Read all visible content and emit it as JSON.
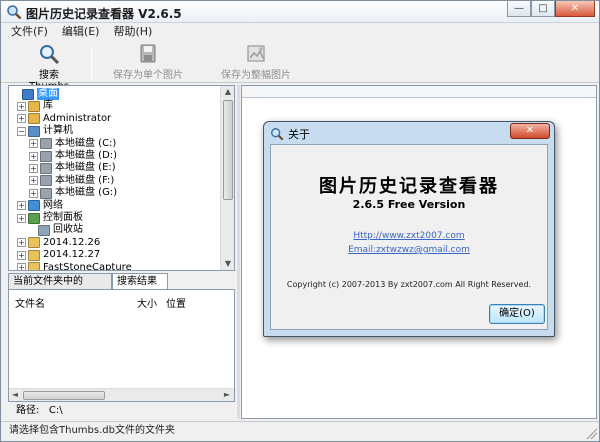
{
  "window": {
    "title": "图片历史记录查看器 V2.6.5",
    "minimize": "—",
    "maximize": "□",
    "close": "✕"
  },
  "menu": {
    "items": [
      "文件(F)",
      "编辑(E)",
      "帮助(H)"
    ]
  },
  "toolbar": {
    "search_label": "搜索Thumbs",
    "save_single_label": "保存为单个图片",
    "save_whole_label": "保存为整幅图片"
  },
  "tree": {
    "items": [
      {
        "label": "桌面",
        "icon": "desktop-icon",
        "expander": ""
      },
      {
        "label": "库",
        "icon": "library-icon",
        "expander": "+"
      },
      {
        "label": "Administrator",
        "icon": "user-folder-icon",
        "expander": "+"
      },
      {
        "label": "计算机",
        "icon": "computer-icon",
        "expander": "−"
      },
      {
        "label": "本地磁盘 (C:)",
        "icon": "drive-icon",
        "expander": "+"
      },
      {
        "label": "本地磁盘 (D:)",
        "icon": "drive-icon",
        "expander": "+"
      },
      {
        "label": "本地磁盘 (E:)",
        "icon": "drive-icon",
        "expander": "+"
      },
      {
        "label": "本地磁盘 (F:)",
        "icon": "drive-icon",
        "expander": "+"
      },
      {
        "label": "本地磁盘 (G:)",
        "icon": "drive-icon",
        "expander": "+"
      },
      {
        "label": "网络",
        "icon": "network-icon",
        "expander": "+"
      },
      {
        "label": "控制面板",
        "icon": "control-panel-icon",
        "expander": "+"
      },
      {
        "label": "回收站",
        "icon": "recycle-bin-icon",
        "expander": ""
      },
      {
        "label": "2014.12.26",
        "icon": "folder-icon",
        "expander": "+"
      },
      {
        "label": "2014.12.27",
        "icon": "folder-icon",
        "expander": "+"
      },
      {
        "label": "FastStoneCapture",
        "icon": "folder-icon",
        "expander": "+"
      }
    ]
  },
  "tabs": [
    {
      "label": "当前文件夹中的Thumbs",
      "active": false
    },
    {
      "label": "搜索结果",
      "active": true
    }
  ],
  "results": {
    "columns": [
      "文件名",
      "大小",
      "位置"
    ]
  },
  "path": {
    "label": "路径:",
    "value": "C:\\"
  },
  "status": {
    "text": "请选择包含Thumbs.db文件的文件夹"
  },
  "about": {
    "title": "关于",
    "close": "✕",
    "app_name": "图片历史记录查看器",
    "version": "2.6.5 Free Version",
    "url": "Http://www.zxt2007.com",
    "email": "Email:zxtwzwz@gmail.com",
    "copyright": "Copyright (c) 2007-2013 By zxt2007.com All Right Reserved.",
    "ok_label": "确定(O)"
  }
}
